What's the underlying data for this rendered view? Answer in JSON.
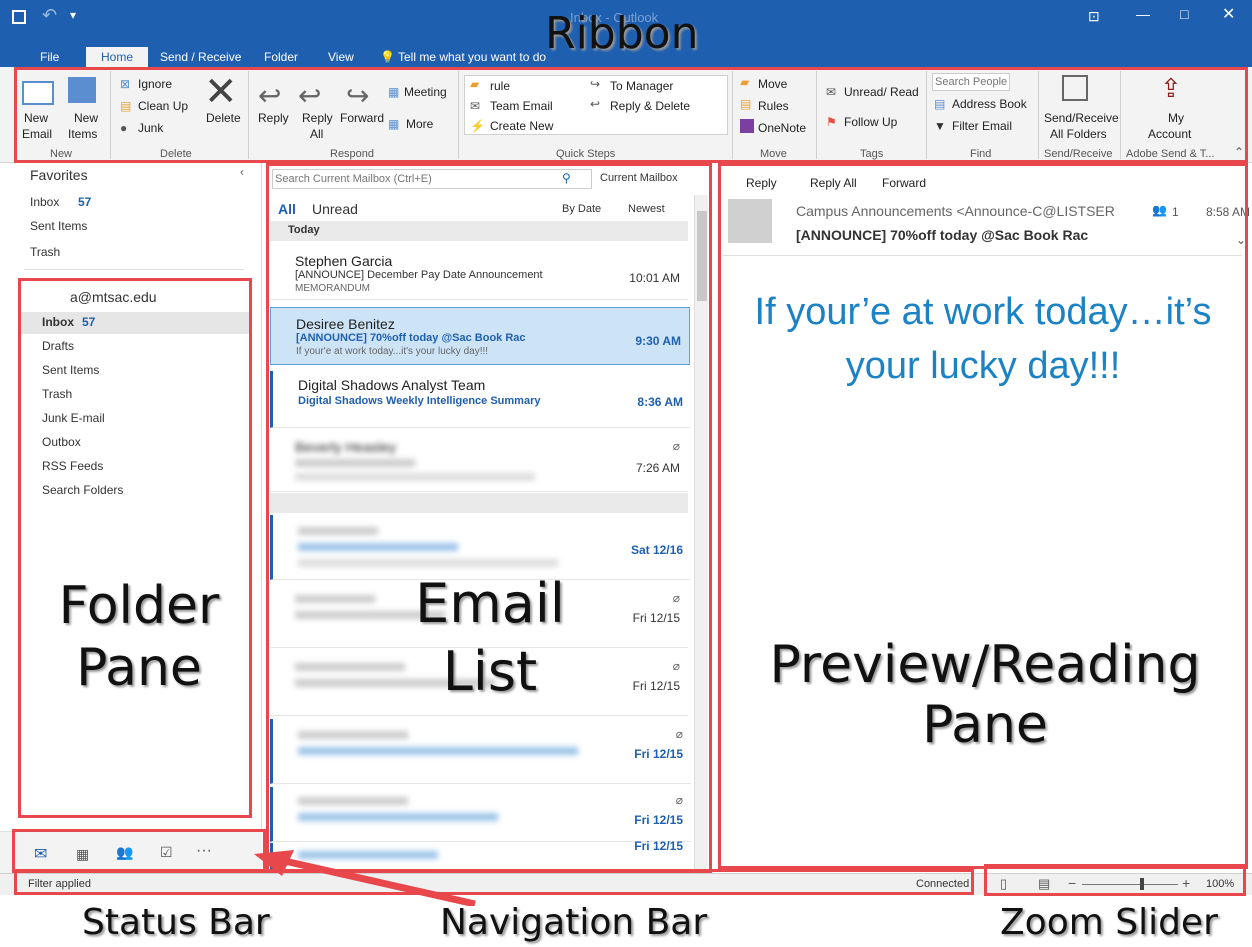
{
  "window": {
    "title": "Inbox - Outlook"
  },
  "tabs": [
    "File",
    "Home",
    "Send / Receive",
    "Folder",
    "View"
  ],
  "tell_me": "Tell me what you want to do",
  "ribbon": {
    "new": {
      "new_email": "New",
      "new_email2": "Email",
      "new_items": "New",
      "new_items2": "Items",
      "label": "New"
    },
    "delete": {
      "ignore": "Ignore",
      "clean_up": "Clean Up",
      "junk": "Junk",
      "delete": "Delete",
      "label": "Delete"
    },
    "respond": {
      "reply": "Reply",
      "reply_all": "Reply",
      "reply_all2": "All",
      "forward": "Forward",
      "meeting": "Meeting",
      "more": "More",
      "label": "Respond"
    },
    "quick_steps": {
      "items": [
        "rule",
        "Team Email",
        "Create New",
        "To Manager",
        "Reply & Delete"
      ],
      "label": "Quick Steps"
    },
    "move": {
      "move": "Move",
      "rules": "Rules",
      "onenote": "OneNote",
      "label": "Move"
    },
    "tags": {
      "unread_read": "Unread/ Read",
      "follow_up": "Follow Up",
      "label": "Tags"
    },
    "find": {
      "search_people": "Search People",
      "address_book": "Address Book",
      "filter_email": "Filter Email",
      "label": "Find"
    },
    "sendreceive": {
      "line1": "Send/Receive",
      "line2": "All Folders",
      "label": "Send/Receive"
    },
    "account": {
      "line1": "My",
      "line2": "Account",
      "label": "Adobe Send & T..."
    }
  },
  "folders": {
    "favorites_header": "Favorites",
    "favorites": [
      {
        "name": "Inbox",
        "count": "57"
      },
      {
        "name": "Sent Items"
      },
      {
        "name": "Trash"
      }
    ],
    "account": "a@mtsac.edu",
    "items": [
      {
        "name": "Inbox",
        "count": "57"
      },
      {
        "name": "Drafts"
      },
      {
        "name": "Sent Items"
      },
      {
        "name": "Trash"
      },
      {
        "name": "Junk E-mail"
      },
      {
        "name": "Outbox"
      },
      {
        "name": "RSS Feeds"
      },
      {
        "name": "Search Folders"
      }
    ]
  },
  "email_list": {
    "search_placeholder": "Search Current Mailbox (Ctrl+E)",
    "scope": "Current Mailbox",
    "filter_all": "All",
    "filter_unread": "Unread",
    "sort_by": "By Date",
    "sort_order": "Newest",
    "group_today": "Today",
    "emails": [
      {
        "sender": "Stephen Garcia",
        "subject": "[ANNOUNCE] December Pay Date Announcement",
        "preview": "MEMORANDUM",
        "time": "10:01 AM"
      },
      {
        "sender": "Desiree Benitez",
        "subject": "[ANNOUNCE] 70%off today @Sac Book Rac",
        "preview": "If your'e at work today...it's your lucky day!!!",
        "time": "9:30 AM"
      },
      {
        "sender": "Digital Shadows Analyst Team",
        "subject": "Digital Shadows Weekly Intelligence Summary",
        "preview": "",
        "time": "8:36 AM"
      },
      {
        "sender": "Beverly Heasley",
        "subject": "",
        "preview": "",
        "time": "7:26 AM"
      }
    ],
    "older_times": [
      "Sat 12/16",
      "Fri 12/15",
      "Fri 12/15",
      "Fri 12/15",
      "Fri 12/15",
      "Fri 12/15"
    ]
  },
  "reading": {
    "actions": [
      "Reply",
      "Reply All",
      "Forward"
    ],
    "from": "Campus Announcements <Announce-C@LISTSER",
    "people": "1",
    "time": "8:58 AM",
    "subject": "[ANNOUNCE] 70%off today @Sac Book Rac",
    "body": "If your’e at work today…it’s your lucky day!!!"
  },
  "status": {
    "left": "Filter applied",
    "connected": "Connected",
    "zoom": "100%",
    "zoom_level": 1.0
  },
  "annotations": {
    "ribbon": "Ribbon",
    "folder": "Folder Pane",
    "email": "Email List",
    "preview": "Preview/Reading Pane",
    "status": "Status Bar",
    "nav": "Navigation Bar",
    "zoom": "Zoom Slider"
  },
  "colors": {
    "accent": "#1f5fb0",
    "annotation": "#e8474b",
    "body_text": "#1b82c5"
  }
}
